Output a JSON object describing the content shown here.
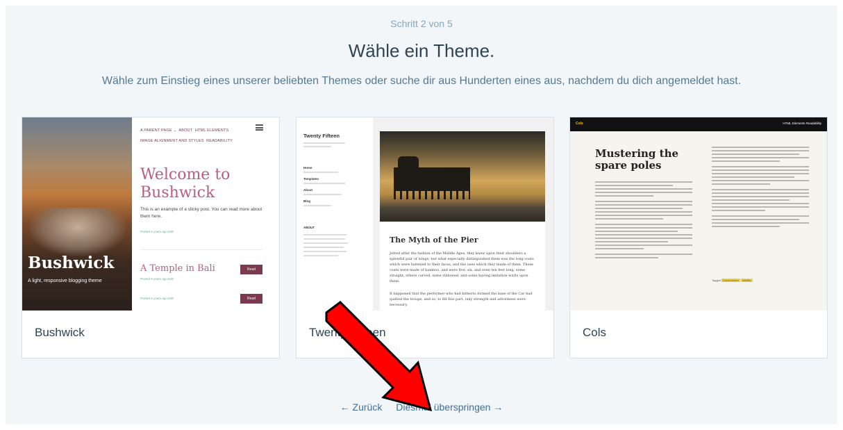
{
  "header": {
    "step": "Schritt 2 von 5",
    "title": "Wähle ein Theme.",
    "subtitle": "Wähle zum Einstieg eines unserer beliebten Themes oder suche dir aus Hunderten eines aus, nachdem du dich angemeldet hast."
  },
  "themes": [
    {
      "name": "Bushwick",
      "preview": {
        "site_title": "Bushwick",
        "tagline": "A light, responsive blogging theme",
        "nav": [
          "A PARENT PAGE ⌄",
          "ABOUT",
          "HTML ELEMENTS",
          "IMAGE ALIGNMENT AND STYLES",
          "READABILITY"
        ],
        "welcome": "Welcome to Bushwick",
        "intro": "This is an example of a sticky post. You can read more about them here.",
        "meta": "Posted 5 years ago Edit",
        "post2": "A Temple in Bali",
        "read": "Read"
      }
    },
    {
      "name": "Twenty Fifteen",
      "preview": {
        "site_title": "Twenty Fifteen",
        "post_title": "The Myth of the Pier",
        "sidebar_headings": [
          "Home",
          "Templates",
          "About",
          "Blog",
          "ABOUT"
        ],
        "para1": "Jetted after the fashion of the Middle Ages, they knew upon their shoulders a splendid pair of wings; but what especially distinguished them was the long coats which were fastened to their faces, and the uses which they made of them. These coats were made of bamboo, and were five, six, and even ten feet long, some straight, others curved, some ribboned, and some having imitation warts upon them.",
        "para2": "It happened that the performer who had hitherto formed the base of the Car had quitted the troupe, and so, to fill this part, only strength and adroitness were necessary."
      }
    },
    {
      "name": "Cols",
      "preview": {
        "logo": "Cols",
        "nav": "HTML Elements   Readability",
        "post_title": "Mustering the spare poles",
        "tags_label": "Tagged",
        "tags": [
          "Environment",
          "Wildlife"
        ]
      }
    }
  ],
  "footer": {
    "back_label": "← Zurück",
    "skip_label": "Diesmal überspringen →"
  },
  "annotation": {
    "arrow_color": "#ff0000"
  }
}
